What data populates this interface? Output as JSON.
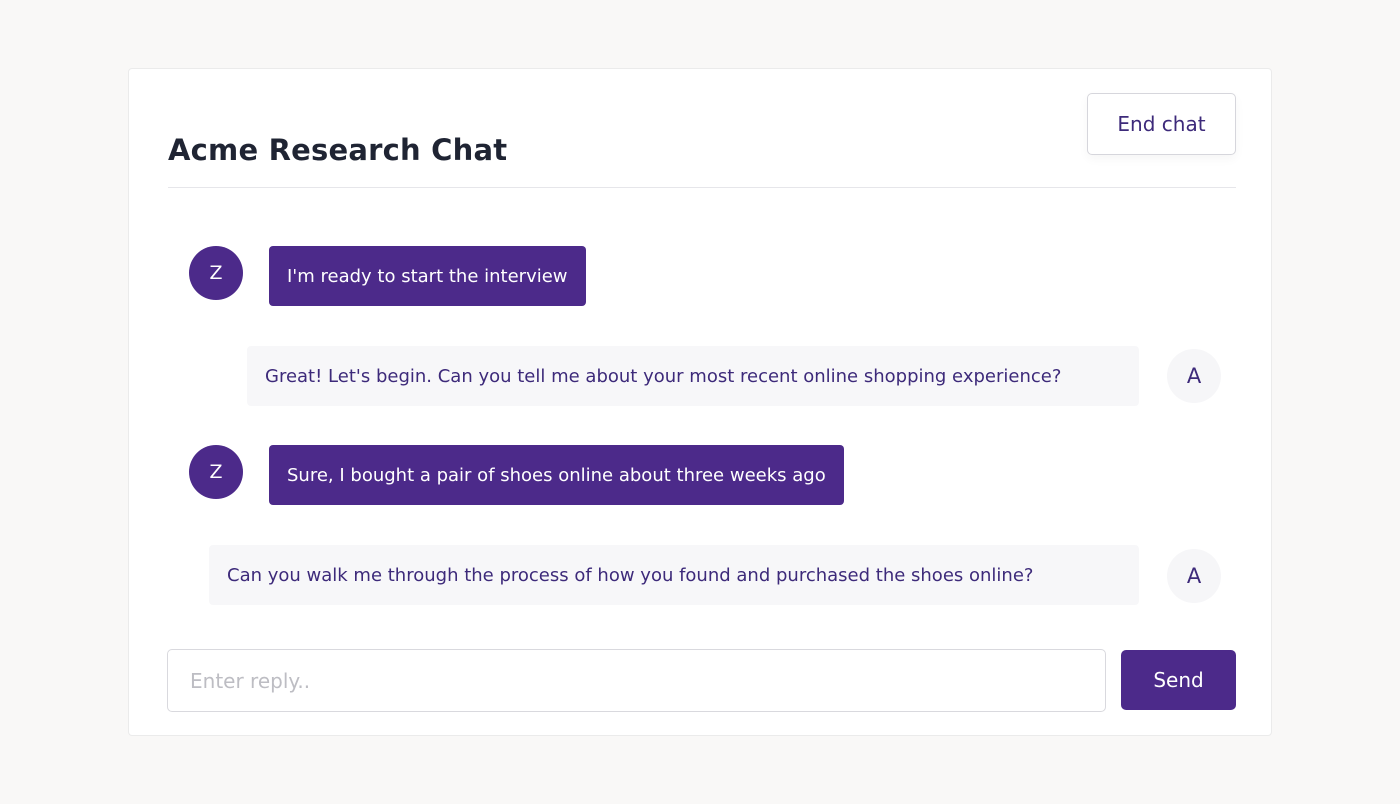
{
  "header": {
    "title": "Acme Research Chat",
    "end_chat_label": "End chat"
  },
  "messages": [
    {
      "sender": "user",
      "avatar": "Z",
      "text": "I'm ready to start the interview"
    },
    {
      "sender": "agent",
      "avatar": "A",
      "text": "Great! Let's begin. Can you tell me about your most recent online shopping experience?"
    },
    {
      "sender": "user",
      "avatar": "Z",
      "text": "Sure, I bought a pair of shoes online about three weeks ago"
    },
    {
      "sender": "agent",
      "avatar": "A",
      "text": "Can you walk me through the process of how you found and purchased the shoes online?"
    }
  ],
  "composer": {
    "placeholder": "Enter reply..",
    "value": "",
    "send_label": "Send"
  },
  "colors": {
    "accent": "#4c2a8a",
    "title": "#1f2433",
    "agent_text": "#3d2a7a",
    "agent_bubble": "#f7f7f9",
    "page_bg": "#f9f8f7"
  }
}
